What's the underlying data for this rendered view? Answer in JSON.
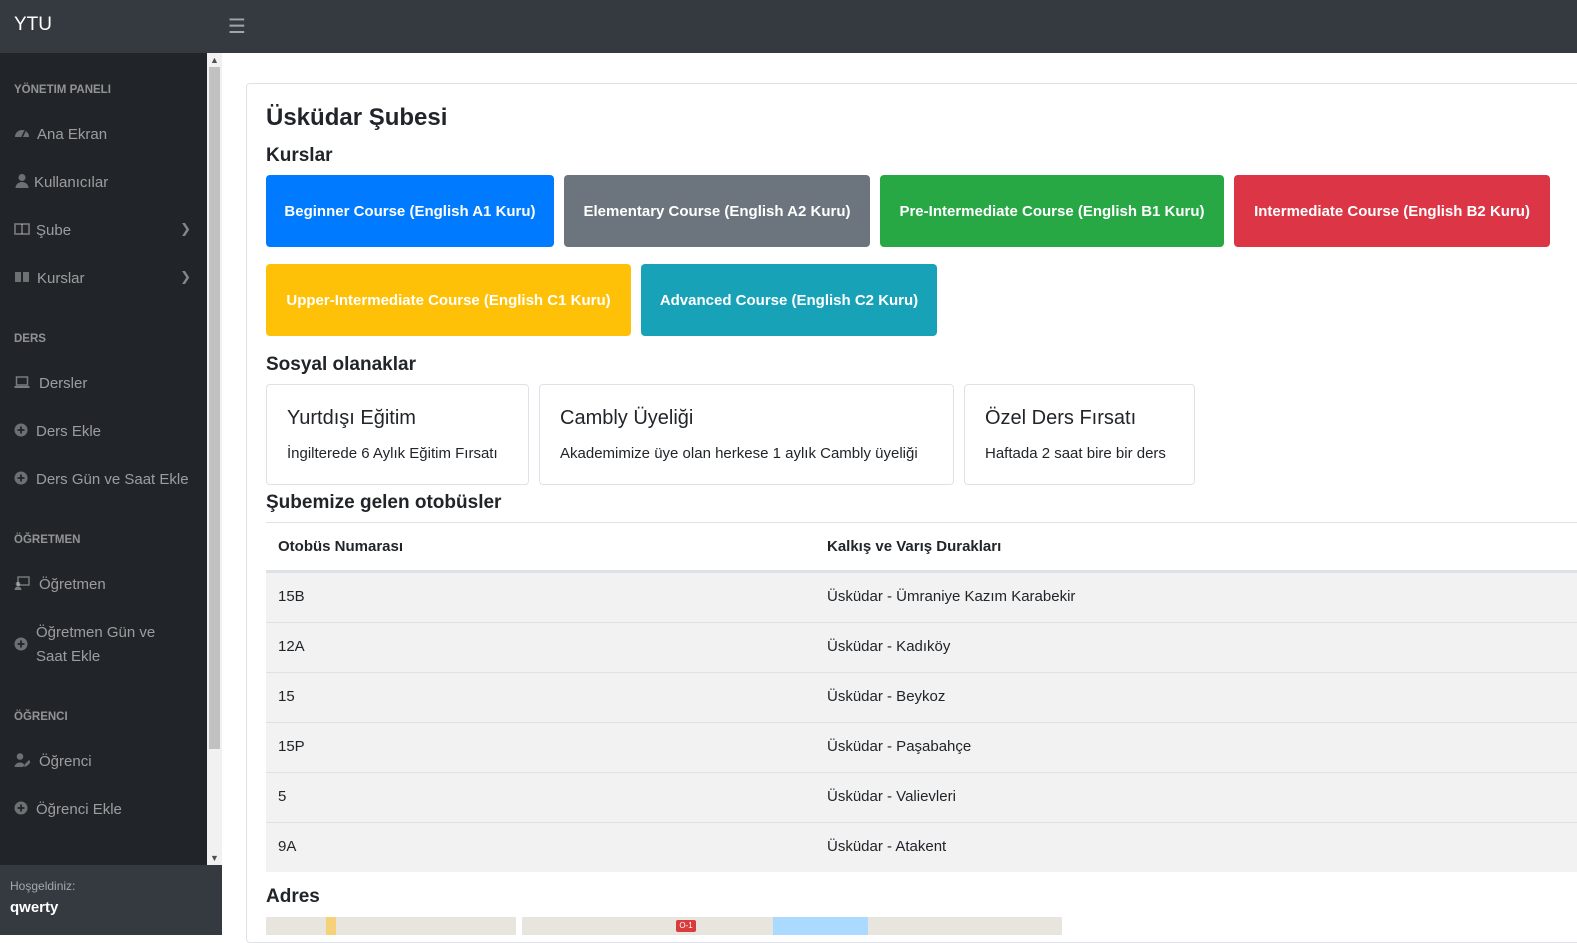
{
  "navbar": {
    "brand": "YTU",
    "toggle_icon": "hamburger-icon"
  },
  "sidebar": {
    "headings": {
      "admin": "YÖNETIM PANELI",
      "lesson": "DERS",
      "teacher": "ÖĞRETMEN",
      "student": "ÖĞRENCI"
    },
    "items": {
      "home": "Ana Ekran",
      "users": "Kullanıcılar",
      "branch": "Şube",
      "courses": "Kurslar",
      "lessons": "Dersler",
      "add_lesson": "Ders Ekle",
      "add_lesson_time": "Ders Gün ve Saat Ekle",
      "teacher": "Öğretmen",
      "teacher_time": "Öğretmen Gün ve Saat Ekle",
      "student": "Öğrenci",
      "add_student": "Öğrenci Ekle"
    },
    "footer": {
      "welcome": "Hoşgeldiniz:",
      "username": "qwerty"
    }
  },
  "main": {
    "title": "Üsküdar Şubesi",
    "courses_heading": "Kurslar",
    "courses": [
      {
        "label": "Beginner Course (English A1 Kuru)",
        "color": "#007bff"
      },
      {
        "label": "Elementary Course (English A2 Kuru)",
        "color": "#6c757d"
      },
      {
        "label": "Pre-Intermediate Course (English B1 Kuru)",
        "color": "#28a745"
      },
      {
        "label": "Intermediate Course (English B2 Kuru)",
        "color": "#dc3545"
      },
      {
        "label": "Upper-Intermediate Course (English C1 Kuru)",
        "color": "#ffc107"
      },
      {
        "label": "Advanced Course (English C2 Kuru)",
        "color": "#17a2b8"
      }
    ],
    "social_heading": "Sosyal olanaklar",
    "social": [
      {
        "title": "Yurtdışı Eğitim",
        "desc": "İngilterede 6 Aylık Eğitim Fırsatı"
      },
      {
        "title": "Cambly Üyeliği",
        "desc": "Akademimize üye olan herkese 1 aylık Cambly üyeliği"
      },
      {
        "title": "Özel Ders Fırsatı",
        "desc": "Haftada 2 saat bire bir ders"
      }
    ],
    "bus_heading": "Şubemize gelen otobüsler",
    "bus_columns": [
      "Otobüs Numarası",
      "Kalkış ve Varış Durakları"
    ],
    "buses": [
      [
        "15B",
        "Üsküdar - Ümraniye Kazım Karabekir"
      ],
      [
        "12A",
        "Üsküdar - Kadıköy"
      ],
      [
        "15",
        "Üsküdar - Beykoz"
      ],
      [
        "15P",
        "Üsküdar - Paşabahçe"
      ],
      [
        "5",
        "Üsküdar - Valievleri"
      ],
      [
        "9A",
        "Üsküdar - Atakent"
      ]
    ],
    "address_heading": "Adres",
    "map_badge": "O-1"
  }
}
